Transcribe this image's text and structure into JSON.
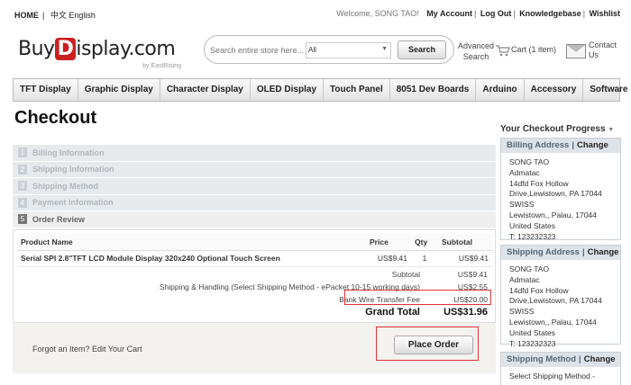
{
  "top": {
    "home": "HOME",
    "languages": [
      "中文",
      "English"
    ],
    "welcome": "Welcome, SONG TAO!",
    "links": [
      "My Account",
      "Log Out",
      "Knowledgebase",
      "Wishlist"
    ]
  },
  "header": {
    "logo_pre": "Buy",
    "logo_d": "D",
    "logo_post": "isplay.com",
    "logo_by": "by EastRising",
    "search_placeholder": "Search entire store here...",
    "search_category": "All",
    "search_button": "Search",
    "advanced_search": "Advanced Search",
    "cart": "Cart (1 item)",
    "contact": "Contact Us"
  },
  "nav": [
    "TFT Display",
    "Graphic Display",
    "Character Display",
    "OLED Display",
    "Touch Panel",
    "8051 Dev Boards",
    "Arduino",
    "Accessory",
    "Software"
  ],
  "page_title": "Checkout",
  "steps": [
    {
      "num": "1",
      "label": "Billing Information"
    },
    {
      "num": "2",
      "label": "Shipping Information"
    },
    {
      "num": "3",
      "label": "Shipping Method"
    },
    {
      "num": "4",
      "label": "Payment Information"
    },
    {
      "num": "5",
      "label": "Order Review"
    }
  ],
  "table": {
    "headers": [
      "Product Name",
      "Price",
      "Qty",
      "Subtotal"
    ],
    "row": {
      "name": "Serial SPI 2.8\"TFT LCD Module Display 320x240 Optional Touch Screen",
      "price": "US$9.41",
      "qty": "1",
      "subtotal": "US$9.41"
    }
  },
  "totals": [
    {
      "label": "Subtotal",
      "value": "US$9.41"
    },
    {
      "label": "Shipping & Handling (Select Shipping Method - ePacket 10-15 working days)",
      "value": "US$2.55"
    },
    {
      "label": "Bank Wire Transfer Fee",
      "value": "US$20.00"
    },
    {
      "label": "Grand Total",
      "value": "US$31.96"
    }
  ],
  "forgot": "Forgot an Item? Edit Your Cart",
  "place_order": "Place Order",
  "sidebar": {
    "title": "Your Checkout Progress",
    "billing": {
      "title": "Billing Address",
      "change": "Change",
      "lines": [
        "SONG TAO",
        "Admatac",
        "14dfd Fox Hollow",
        "Drive,Lewistown, PA 17044",
        "SWISS",
        "Lewistown,, Palau, 17044",
        "United States",
        "T: 123232323"
      ]
    },
    "shipping": {
      "title": "Shipping Address",
      "change": "Change",
      "lines": [
        "SONG TAO",
        "Admatac",
        "14dfd Fox Hollow",
        "Drive,Lewistown, PA 17044",
        "SWISS",
        "Lewistown,, Palau, 17044",
        "United States",
        "T: 123232323"
      ]
    },
    "method": {
      "title": "Shipping Method",
      "change": "Change",
      "lines": [
        "Select Shipping Method -"
      ]
    }
  }
}
